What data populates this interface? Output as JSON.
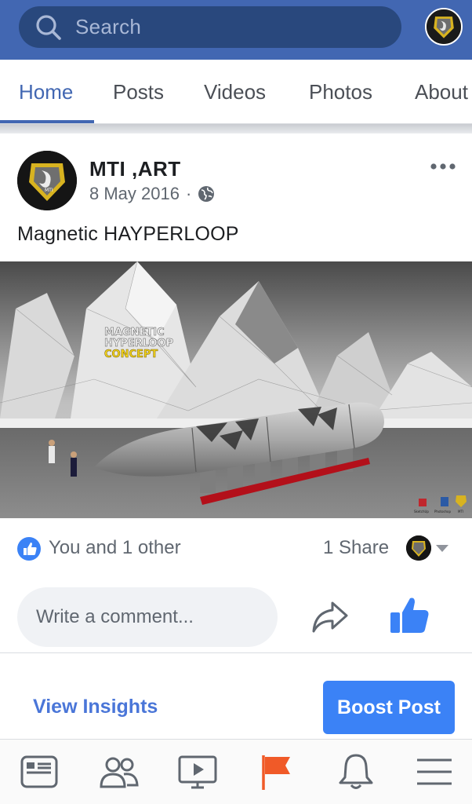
{
  "search": {
    "placeholder": "Search"
  },
  "tabs": [
    {
      "label": "Home",
      "active": true
    },
    {
      "label": "Posts"
    },
    {
      "label": "Videos"
    },
    {
      "label": "Photos"
    },
    {
      "label": "About"
    }
  ],
  "post": {
    "author": "MTI ,ART",
    "date": "8 May 2016",
    "separator": "·",
    "audience_icon": "globe-icon",
    "text": "Magnetic HAYPERLOOP",
    "image_caption": {
      "line1": "MAGNETIC",
      "line2": "HYPERLOOP",
      "line3": "CONCEPT"
    },
    "image_watermarks": [
      "SketchUp",
      "Photoshop",
      "MTI"
    ]
  },
  "reactions": {
    "text": "You and 1 other",
    "shares": "1 Share"
  },
  "comment": {
    "placeholder": "Write a comment..."
  },
  "actions": {
    "insights": "View Insights",
    "boost": "Boost Post"
  },
  "bottom_nav": [
    "news-feed-icon",
    "friends-icon",
    "watch-icon",
    "pages-flag-icon",
    "notifications-bell-icon",
    "menu-icon"
  ],
  "colors": {
    "brand": "#4267b2",
    "search_bg": "#29487d",
    "accent_blue": "#3b82f6",
    "flag": "#f05a28"
  }
}
